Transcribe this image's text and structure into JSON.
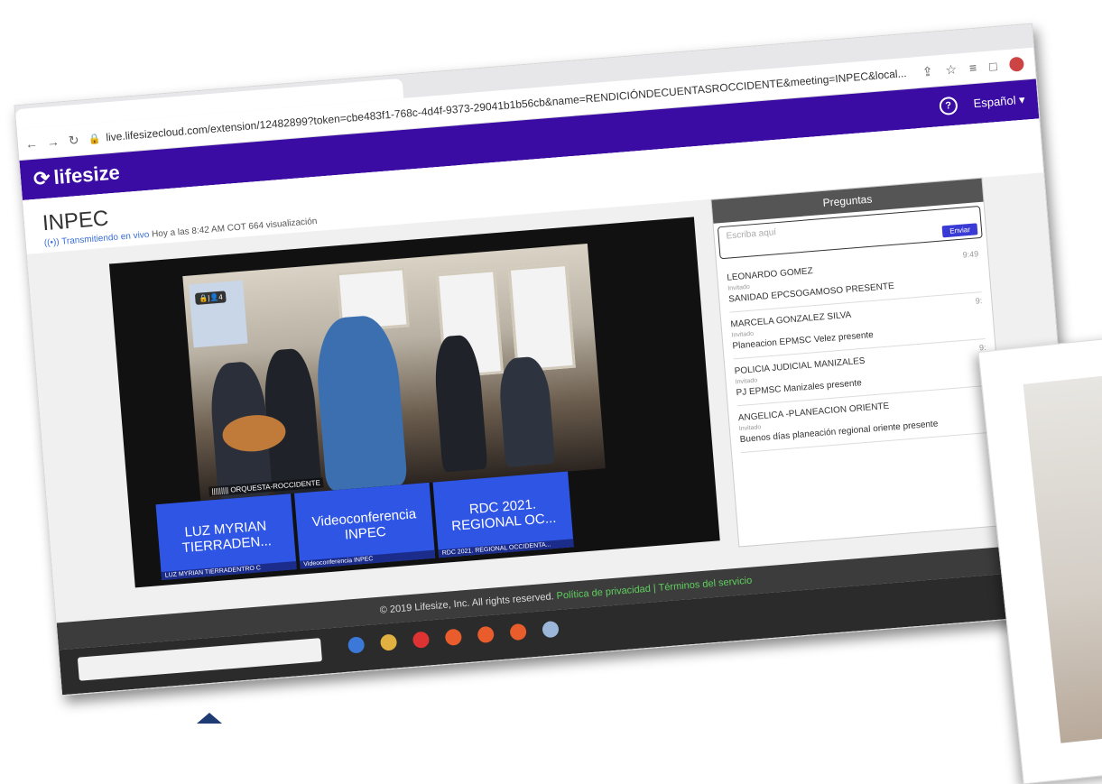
{
  "browser": {
    "url": "live.lifesizecloud.com/extension/12482899?token=cbe483f1-768c-4d4f-9373-29041b1b56cb&name=RENDICIÓNDECUENTASROCCIDENTE&meeting=INPEC&local..."
  },
  "lifesize": {
    "brand": "lifesize",
    "language": "Español"
  },
  "event": {
    "title": "INPEC",
    "live_label": "Transmitiendo en vivo",
    "date": "Hoy a las 8:42 AM COT",
    "views": "664 visualización"
  },
  "video": {
    "badge": "🔒|👤4",
    "overlay_label": "||||||||| ORQUESTA-ROCCIDENTE"
  },
  "tiles": [
    {
      "title": "LUZ MYRIAN TIERRADEN...",
      "sub": "LUZ MYRIAN TIERRADENTRO C"
    },
    {
      "title": "Videoconferencia INPEC",
      "sub": "Videoconferencia INPEC"
    },
    {
      "title": "RDC 2021. REGIONAL OC...",
      "sub": "RDC 2021. REGIONAL OCCIDENTA..."
    }
  ],
  "questions_panel": {
    "header": "Preguntas",
    "placeholder": "Escriba aquí",
    "send": "Enviar",
    "items": [
      {
        "name": "LEONARDO GOMEZ",
        "role": "Invitado",
        "message": "SANIDAD EPCSOGAMOSO PRESENTE",
        "time": "9:49"
      },
      {
        "name": "MARCELA GONZALEZ SILVA",
        "role": "Invitado",
        "message": "Planeacion EPMSC Velez presente",
        "time": "9:"
      },
      {
        "name": "POLICIA JUDICIAL MANIZALES",
        "role": "Invitado",
        "message": "PJ EPMSC Manizales presente",
        "time": "9:"
      },
      {
        "name": "ANGELICA -PLANEACION ORIENTE",
        "role": "Invitado",
        "message": "Buenos días planeación regional oriente presente",
        "time": "9:"
      }
    ]
  },
  "footer": {
    "copyright": "© 2019 Lifesize, Inc. All rights reserved.",
    "privacy": "Política de privacidad",
    "separator": "|",
    "terms": "Términos del servicio"
  }
}
